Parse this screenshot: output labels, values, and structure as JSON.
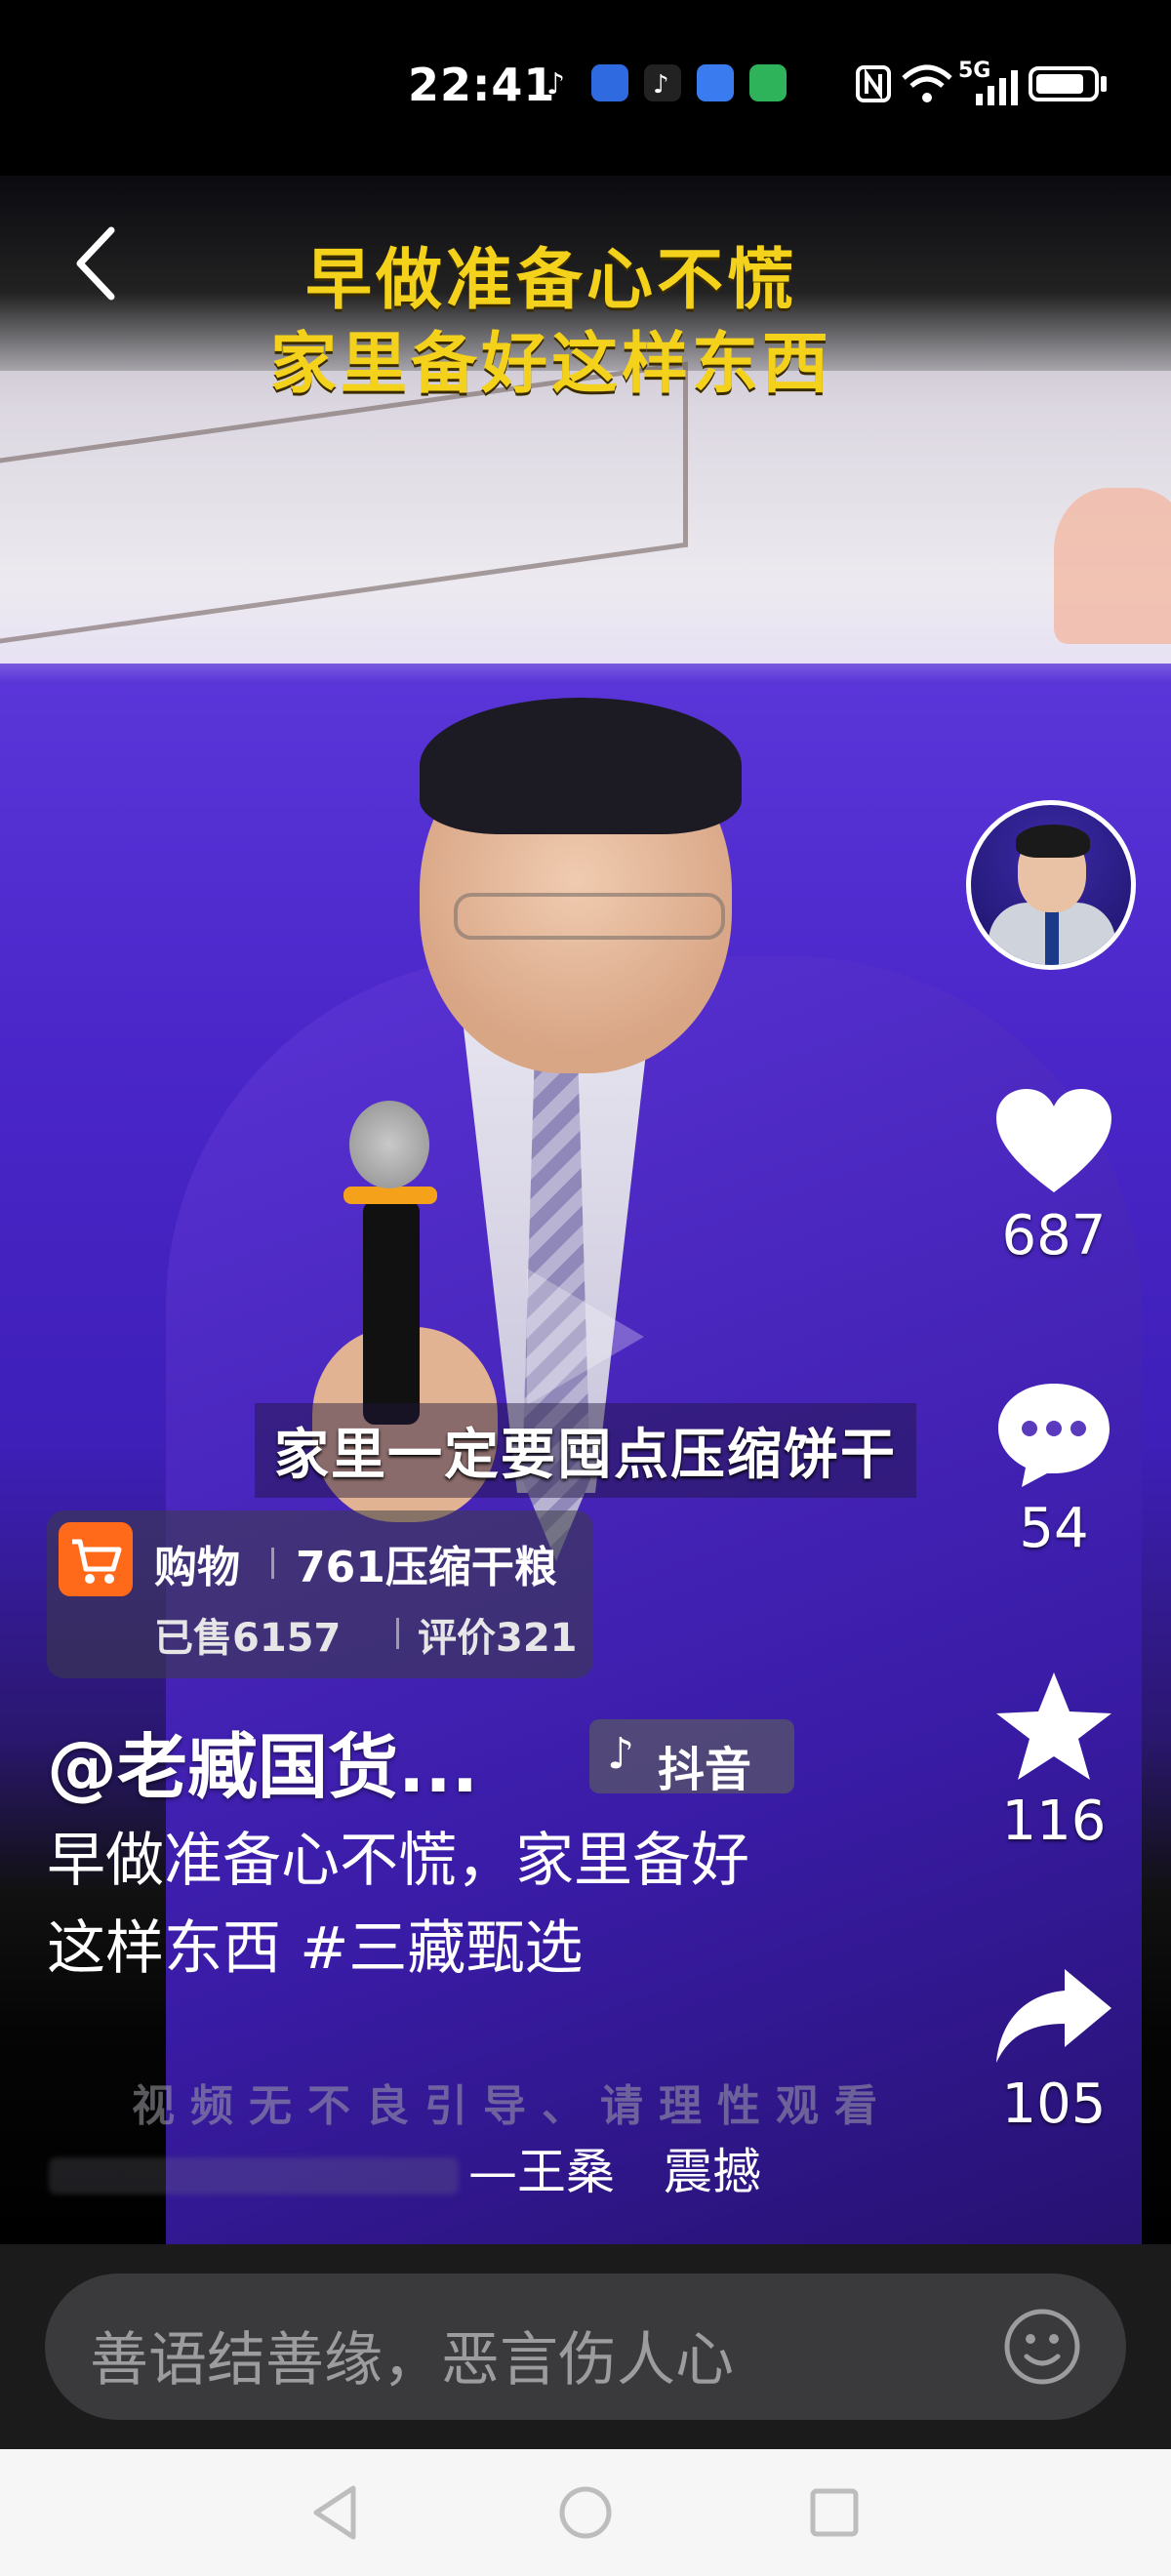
{
  "status_bar": {
    "time": "22:41",
    "network": "5G",
    "battery_level": 0.85,
    "app_icons": [
      "douyin-icon",
      "app-blue-icon",
      "douyin-icon",
      "app-blue-icon",
      "app-green-icon"
    ]
  },
  "video": {
    "title_line1": "早做准备心不慌",
    "title_line2": "家里备好这样东西",
    "subtitle": "家里一定要囤点压缩饼干",
    "disclaimer": "视频无不良引导、请理性观看"
  },
  "actions": {
    "likes": "687",
    "comments": "54",
    "favorites": "116",
    "shares": "105"
  },
  "shop": {
    "label": "购物",
    "item": "761压缩干粮",
    "sold": "已售6157",
    "reviews": "评价321"
  },
  "post": {
    "author": "@老臧国货...",
    "platform_badge": "抖音",
    "description": "早做准备心不慌，家里备好这样东西 #三藏甄选",
    "music": "—王桑　震撼"
  },
  "comment": {
    "placeholder": "善语结善缘，恶言伤人心"
  },
  "colors": {
    "title_yellow": "#f4d21c",
    "cart_orange": "#ff6a1a",
    "suit_purple": "#4a26c9"
  }
}
